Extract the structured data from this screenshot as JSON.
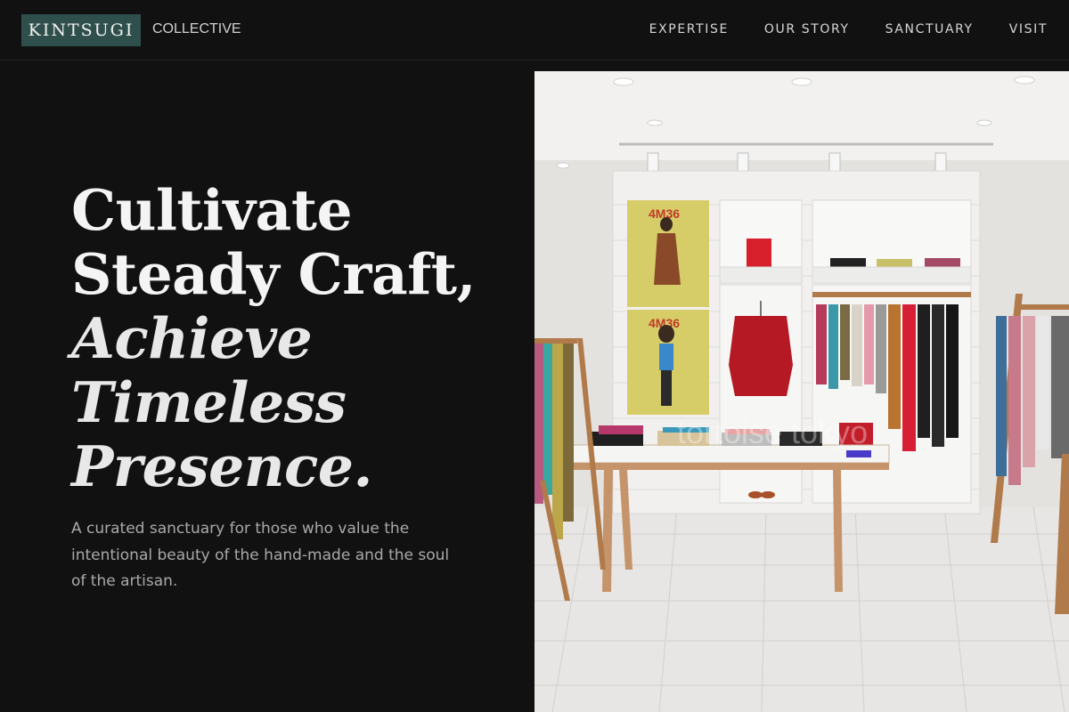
{
  "brand": {
    "name": "KINTSUGI",
    "suffix": "COLLECTIVE",
    "color": "#2f4f4c"
  },
  "nav": {
    "items": [
      "EXPERTISE",
      "OUR STORY",
      "SANCTUARY",
      "VISIT"
    ]
  },
  "hero": {
    "lines": [
      "Cultivate",
      "Steady Craft,"
    ],
    "italic_lines": [
      "Achieve",
      "Timeless",
      "Presence."
    ],
    "description": "A curated sanctuary for those who value the intentional beauty of the hand-made and the soul of the artisan."
  },
  "photo": {
    "poster_text_top": "4M36",
    "poster_text_bottom": "4M36",
    "watermark": "tortoise tokyo"
  }
}
